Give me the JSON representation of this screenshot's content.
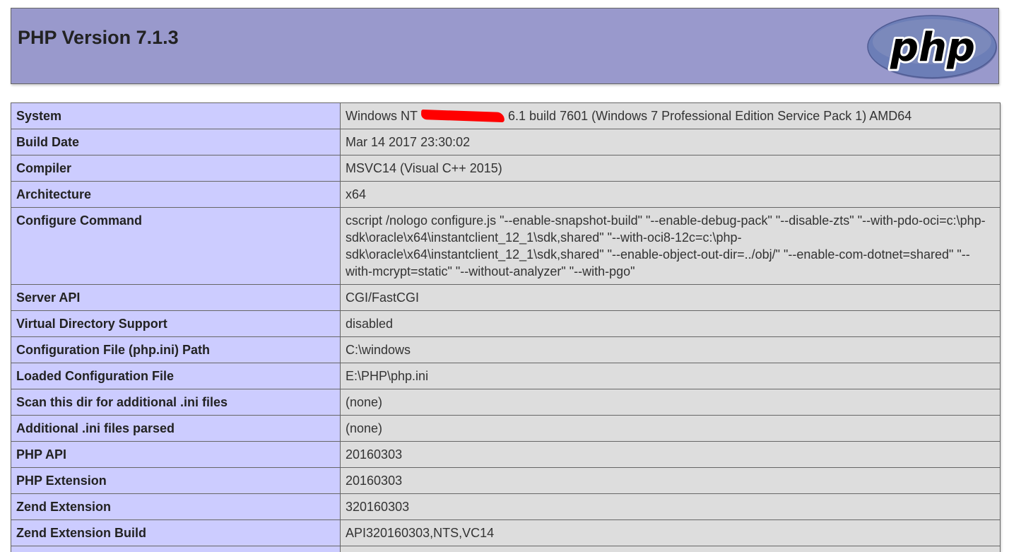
{
  "header": {
    "title": "PHP Version 7.1.3",
    "logo_text": "php"
  },
  "colors": {
    "header_bg": "#9999cc",
    "key_cell_bg": "#ccccff",
    "value_cell_bg": "#dddddd",
    "logo_oval": "#6c7eb7",
    "redaction": "#ff0000"
  },
  "info": {
    "rows": [
      {
        "key": "System",
        "value_before": "Windows NT",
        "value_after": "6.1 build 7601 (Windows 7 Professional Edition Service Pack 1) AMD64"
      },
      {
        "key": "Build Date",
        "value": "Mar 14 2017 23:30:02"
      },
      {
        "key": "Compiler",
        "value": "MSVC14 (Visual C++ 2015)"
      },
      {
        "key": "Architecture",
        "value": "x64"
      },
      {
        "key": "Configure Command",
        "value": "cscript /nologo configure.js \"--enable-snapshot-build\" \"--enable-debug-pack\" \"--disable-zts\" \"--with-pdo-oci=c:\\php-sdk\\oracle\\x64\\instantclient_12_1\\sdk,shared\" \"--with-oci8-12c=c:\\php-sdk\\oracle\\x64\\instantclient_12_1\\sdk,shared\" \"--enable-object-out-dir=../obj/\" \"--enable-com-dotnet=shared\" \"--with-mcrypt=static\" \"--without-analyzer\" \"--with-pgo\""
      },
      {
        "key": "Server API",
        "value": "CGI/FastCGI"
      },
      {
        "key": "Virtual Directory Support",
        "value": "disabled"
      },
      {
        "key": "Configuration File (php.ini) Path",
        "value": "C:\\windows"
      },
      {
        "key": "Loaded Configuration File",
        "value": "E:\\PHP\\php.ini"
      },
      {
        "key": "Scan this dir for additional .ini files",
        "value": "(none)"
      },
      {
        "key": "Additional .ini files parsed",
        "value": "(none)"
      },
      {
        "key": "PHP API",
        "value": "20160303"
      },
      {
        "key": "PHP Extension",
        "value": "20160303"
      },
      {
        "key": "Zend Extension",
        "value": "320160303"
      },
      {
        "key": "Zend Extension Build",
        "value": "API320160303,NTS,VC14"
      },
      {
        "key": "",
        "value": ""
      }
    ]
  }
}
